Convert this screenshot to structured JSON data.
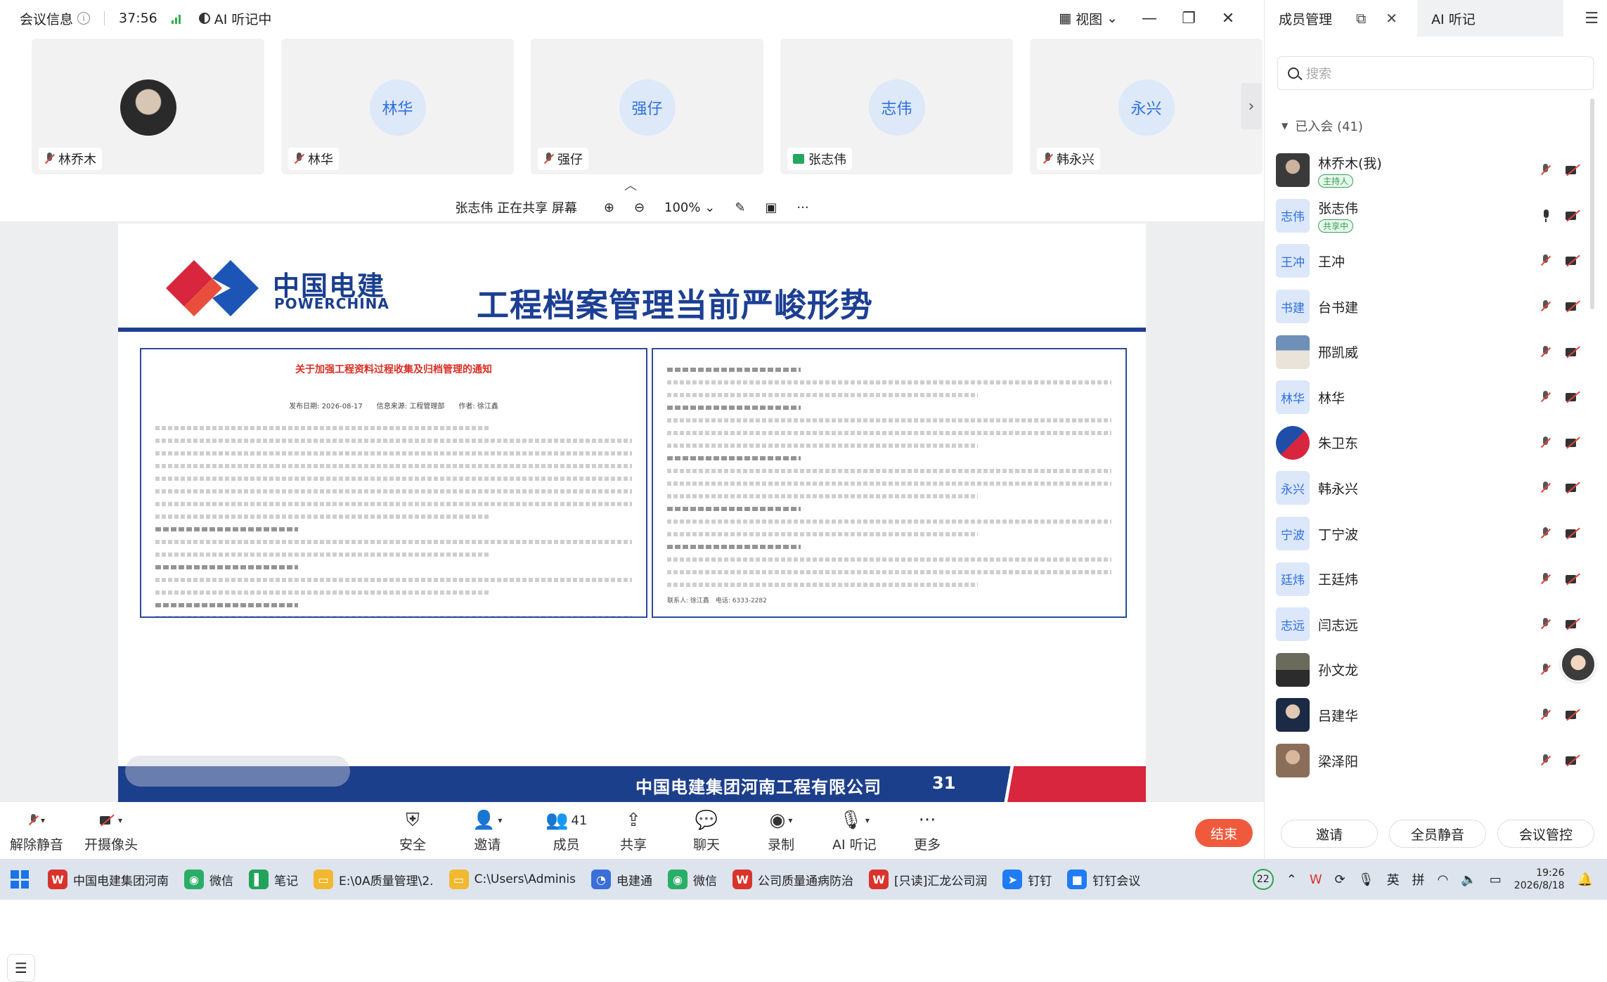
{
  "topbar": {
    "meeting_info": "会议信息",
    "timer": "37:56",
    "ai_notes": "AI 听记中",
    "view_label": "视图"
  },
  "thumbnails": [
    {
      "name": "林乔木",
      "avatar_text": "",
      "type": "photo",
      "mic": "off"
    },
    {
      "name": "林华",
      "avatar_text": "林华",
      "type": "initials",
      "mic": "off"
    },
    {
      "name": "强仔",
      "avatar_text": "强仔",
      "type": "initials",
      "mic": "off"
    },
    {
      "name": "张志伟",
      "avatar_text": "志伟",
      "type": "initials",
      "mic": "sharing"
    },
    {
      "name": "韩永兴",
      "avatar_text": "永兴",
      "type": "initials",
      "mic": "off"
    }
  ],
  "sharebar": {
    "status": "张志伟 正在共享 屏幕",
    "zoom": "100%"
  },
  "slide": {
    "logo_cn": "中国电建",
    "logo_en": "POWERCHINA",
    "title": "工程档案管理当前严峻形势",
    "doc_left_title": "关于加强工程资料过程收集及归档管理的通知",
    "doc_left_meta": "发布日期: 2026-08-17　　信息来源: 工程管理部　　作者: 徐江鑫",
    "doc_right_contact": "联系人: 徐江鑫　电话: 6333-2282",
    "footer_company": "中国电建集团河南工程有限公司",
    "page_number": "31"
  },
  "toolbar": {
    "unmute": "解除静音",
    "camera": "开摄像头",
    "security": "安全",
    "invite": "邀请",
    "members": "成员",
    "members_count": "41",
    "share": "共享",
    "chat": "聊天",
    "record": "录制",
    "ai_notes": "AI 听记",
    "more": "更多",
    "end": "结束"
  },
  "panel": {
    "tab_members": "成员管理",
    "tab_ai": "AI 听记",
    "search_placeholder": "搜索",
    "joined_label": "已入会 (41)",
    "members": [
      {
        "name": "林乔木(我)",
        "badge": "主持人",
        "avatar_text": "",
        "avatar": "photo1",
        "mic": "off"
      },
      {
        "name": "张志伟",
        "badge": "共享中",
        "avatar_text": "志伟",
        "avatar": "initials",
        "mic": "on"
      },
      {
        "name": "王冲",
        "badge": "",
        "avatar_text": "王冲",
        "avatar": "initials",
        "mic": "off"
      },
      {
        "name": "台书建",
        "badge": "",
        "avatar_text": "书建",
        "avatar": "initials",
        "mic": "off"
      },
      {
        "name": "邢凯威",
        "badge": "",
        "avatar_text": "",
        "avatar": "photo2",
        "mic": "off"
      },
      {
        "name": "林华",
        "badge": "",
        "avatar_text": "林华",
        "avatar": "initials",
        "mic": "off"
      },
      {
        "name": "朱卫东",
        "badge": "",
        "avatar_text": "",
        "avatar": "photo3",
        "mic": "off"
      },
      {
        "name": "韩永兴",
        "badge": "",
        "avatar_text": "永兴",
        "avatar": "initials",
        "mic": "off"
      },
      {
        "name": "丁宁波",
        "badge": "",
        "avatar_text": "宁波",
        "avatar": "initials",
        "mic": "off"
      },
      {
        "name": "王廷炜",
        "badge": "",
        "avatar_text": "廷炜",
        "avatar": "initials",
        "mic": "off"
      },
      {
        "name": "闫志远",
        "badge": "",
        "avatar_text": "志远",
        "avatar": "initials",
        "mic": "off"
      },
      {
        "name": "孙文龙",
        "badge": "",
        "avatar_text": "",
        "avatar": "photo4",
        "mic": "off"
      },
      {
        "name": "吕建华",
        "badge": "",
        "avatar_text": "",
        "avatar": "photo5",
        "mic": "off"
      },
      {
        "name": "梁泽阳",
        "badge": "",
        "avatar_text": "",
        "avatar": "photo6",
        "mic": "off"
      }
    ],
    "footer": {
      "invite": "邀请",
      "mute_all": "全员静音",
      "control": "会议管控"
    }
  },
  "taskbar": {
    "items": [
      {
        "label": "中国电建集团河南",
        "icon": "W",
        "color": "#d9342b"
      },
      {
        "label": "微信",
        "icon": "◉",
        "color": "#2aae67"
      },
      {
        "label": "笔记",
        "icon": "▌",
        "color": "#21a35a"
      },
      {
        "label": "E:\\0A质量管理\\2.",
        "icon": "▭",
        "color": "#f2b830"
      },
      {
        "label": "C:\\Users\\Adminis",
        "icon": "▭",
        "color": "#f2b830"
      },
      {
        "label": "电建通",
        "icon": "◔",
        "color": "#3a6fd8"
      },
      {
        "label": "微信",
        "icon": "◉",
        "color": "#2aae67"
      },
      {
        "label": "公司质量通病防治",
        "icon": "W",
        "color": "#d9342b"
      },
      {
        "label": "[只读]汇龙公司润",
        "icon": "W",
        "color": "#d9342b"
      },
      {
        "label": "钉钉",
        "icon": "➤",
        "color": "#1f7cf2"
      },
      {
        "label": "钉钉会议",
        "icon": "■",
        "color": "#1f7cf2"
      }
    ],
    "tray_count": "22",
    "ime_1": "英",
    "ime_2": "拼",
    "time": "19:26",
    "date": "2026/8/18"
  }
}
